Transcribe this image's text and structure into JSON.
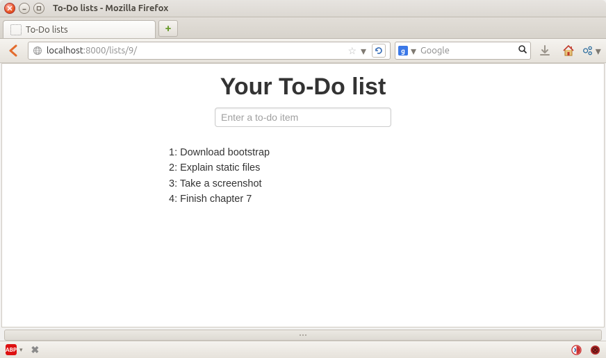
{
  "window": {
    "title": "To-Do lists - Mozilla Firefox"
  },
  "tabs": [
    {
      "title": "To-Do lists"
    }
  ],
  "url": {
    "host": "localhost",
    "path": ":8000/lists/9/"
  },
  "search": {
    "engine_letter": "g",
    "placeholder": "Google"
  },
  "page": {
    "heading": "Your To-Do list",
    "input_placeholder": "Enter a to-do item",
    "items": [
      "1: Download bootstrap",
      "2: Explain static files",
      "3: Take a screenshot",
      "4: Finish chapter 7"
    ]
  },
  "status": {
    "adblock_label": "ABP"
  }
}
